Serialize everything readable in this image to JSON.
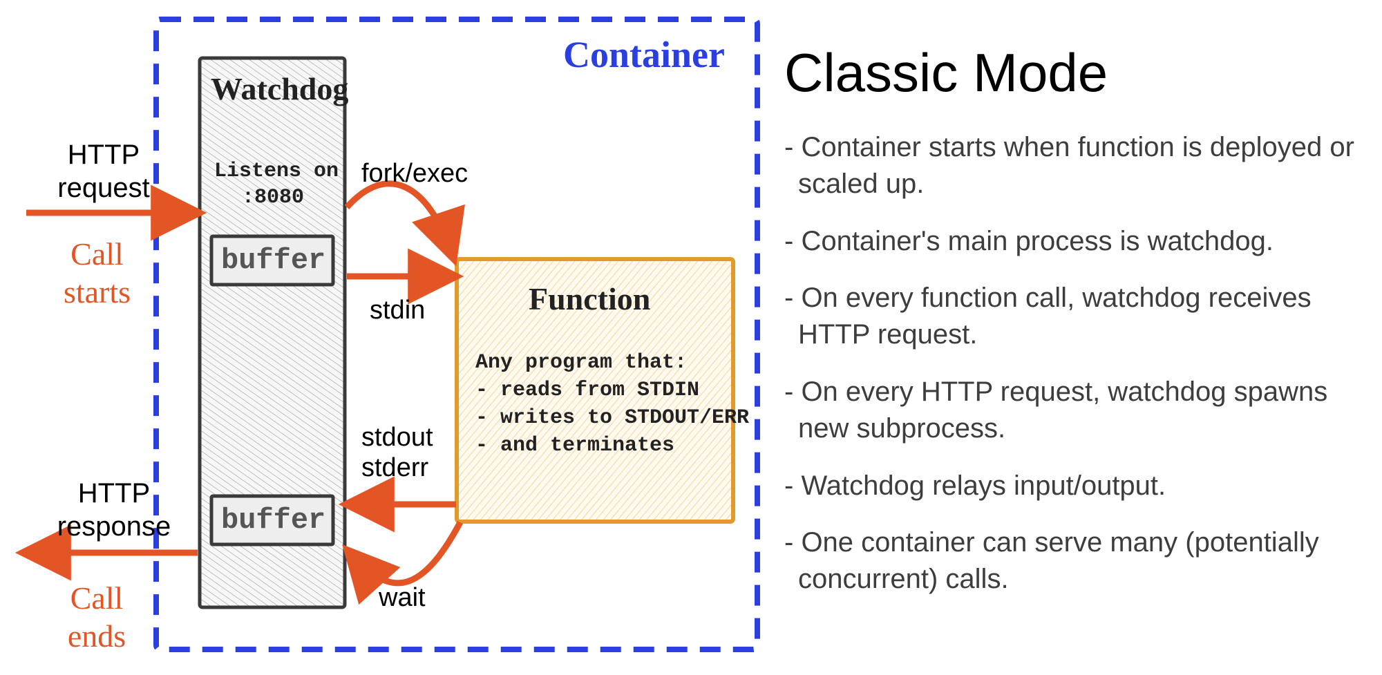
{
  "title": "Classic Mode",
  "container_label": "Container",
  "watchdog": {
    "title": "Watchdog",
    "listens": "Listens on\n:8080",
    "buffer": "buffer"
  },
  "function": {
    "title": "Function",
    "desc1": "Any program that:",
    "desc2": "- reads from STDIN",
    "desc3": "- writes to STDOUT/ERR",
    "desc4": "- and terminates"
  },
  "arrows": {
    "http_request": "HTTP\nrequest",
    "call_starts": "Call\nstarts",
    "http_response": "HTTP\nresponse",
    "call_ends": "Call\nends",
    "fork_exec": "fork/exec",
    "stdin": "stdin",
    "stdout_stderr": "stdout\nstderr",
    "wait": "wait"
  },
  "bullets": [
    "Container starts when function is deployed or scaled up.",
    "Container's main process is watchdog.",
    "On every function call, watchdog receives HTTP request.",
    "On every HTTP request, watchdog spawns new subprocess.",
    "Watchdog relays input/output.",
    "One container can serve many (potentially concurrent) calls."
  ],
  "colors": {
    "blue": "#2b3fe0",
    "red": "#e45526",
    "orange": "#f2a93b",
    "gray": "#444"
  }
}
